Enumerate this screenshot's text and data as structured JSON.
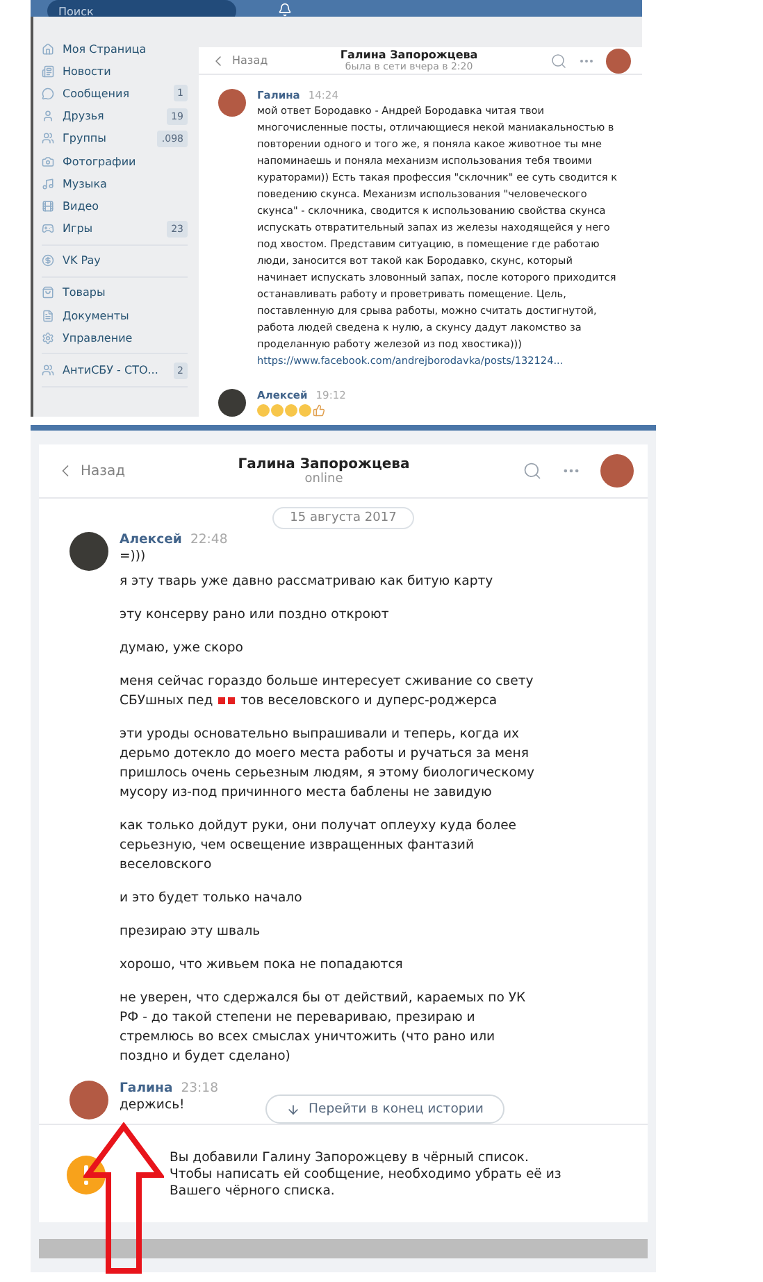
{
  "top_screenshot": {
    "search": {
      "placeholder": "Поиск"
    },
    "sidebar": {
      "groups": [
        [
          {
            "label": "Моя Страница"
          },
          {
            "label": "Новости"
          },
          {
            "label": "Сообщения",
            "count": "1"
          },
          {
            "label": "Друзья",
            "count": "19"
          },
          {
            "label": "Группы",
            "count": ".098"
          },
          {
            "label": "Фотографии"
          },
          {
            "label": "Музыка"
          },
          {
            "label": "Видео"
          },
          {
            "label": "Игры",
            "count": "23"
          }
        ],
        [
          {
            "label": "VK Pay"
          }
        ],
        [
          {
            "label": "Товары"
          },
          {
            "label": "Документы"
          },
          {
            "label": "Управление"
          }
        ],
        [
          {
            "label": "АнтиСБУ - СТО...",
            "count": "2"
          }
        ]
      ]
    },
    "header": {
      "back": "Назад",
      "name": "Галина Запорожцева",
      "status": "была в сети вчера в 2:20"
    },
    "messages": [
      {
        "author": "Галина",
        "time": "14:24",
        "color": "#b35a44",
        "text": "мой ответ Бородавко - Андрей Бородавка читая твои многочисленные посты, отличающиеся некой маниакальностью в повторении одного и того же, я поняла какое животное ты мне напоминаешь и поняла механизм использования тебя твоими кураторами)) Есть такая профессия \"склочник\" ее суть сводится к поведению скунса. Механизм использования \"человеческого скунса\" - склочника, сводится к использованию свойства скунса испускать отвратительный запах из железы находящейся у него под хвостом. Представим ситуацию, в помещение где работаю люди, заносится вот такой как Бородавко, скунс, который начинает испускать зловонный запах, после которого приходится останавливать работу и проветривать помещение. Цель, поставленную для срыва работы, можно считать достигнутой, работа людей сведена к нулю, а скунсу дадут лакомство за проделанную работу железой из под хвостика)))",
        "link": "https://www.facebook.com/andrejborodavka/posts/132124..."
      },
      {
        "author": "Алексей",
        "time": "19:12",
        "color": "#3b3a36",
        "emoji": true
      }
    ]
  },
  "bottom_screenshot": {
    "header": {
      "back": "Назад",
      "name": "Галина Запорожцева",
      "status": "online"
    },
    "date": "15 августа 2017",
    "messages": [
      {
        "author": "Алексей",
        "time": "22:48",
        "color": "#3b3a36",
        "paragraphs": [
          {
            "kind": "text",
            "text": "=)))"
          },
          {
            "kind": "text",
            "text": "я эту тварь уже давно рассматриваю как битую карту"
          },
          {
            "kind": "text",
            "text": "эту консерву рано или поздно откроют"
          },
          {
            "kind": "text",
            "text": "думаю, уже скоро"
          },
          {
            "kind": "redacted",
            "before": "меня сейчас гораздо больше интересует сживание со свету СБУшных пед",
            "after": "тов веселовского и дуперс-роджерса"
          },
          {
            "kind": "text",
            "text": "эти уроды основательно выпрашивали и теперь, когда их дерьмо дотекло до моего места работы и ручаться за меня пришлось очень серьезным людям, я этому биологическому мусору из-под причинного места баблены не завидую"
          },
          {
            "kind": "text",
            "text": "как только дойдут руки, они получат оплеуху куда более серьезную, чем освещение извращенных фантазий веселовского"
          },
          {
            "kind": "text",
            "text": "и это будет только начало"
          },
          {
            "kind": "text",
            "text": "презираю эту шваль"
          },
          {
            "kind": "text",
            "text": "хорошо, что живьем пока не попадаются"
          },
          {
            "kind": "text",
            "text": "не уверен, что сдержался бы от действий, караемых по УК РФ - до такой степени не перевариваю, презираю и стремлюсь во всех смыслах уничтожить (что рано или поздно и будет сделано)"
          }
        ]
      },
      {
        "author": "Галина",
        "time": "23:18",
        "color": "#b35a44",
        "paragraphs": [
          {
            "kind": "text",
            "text": "держись!"
          }
        ]
      }
    ],
    "jump_button": "Перейти в конец истории",
    "notice": "Вы добавили Галину Запорожцеву в чёрный список. Чтобы написать ей сообщение, необходимо убрать её из Вашего чёрного списка."
  }
}
